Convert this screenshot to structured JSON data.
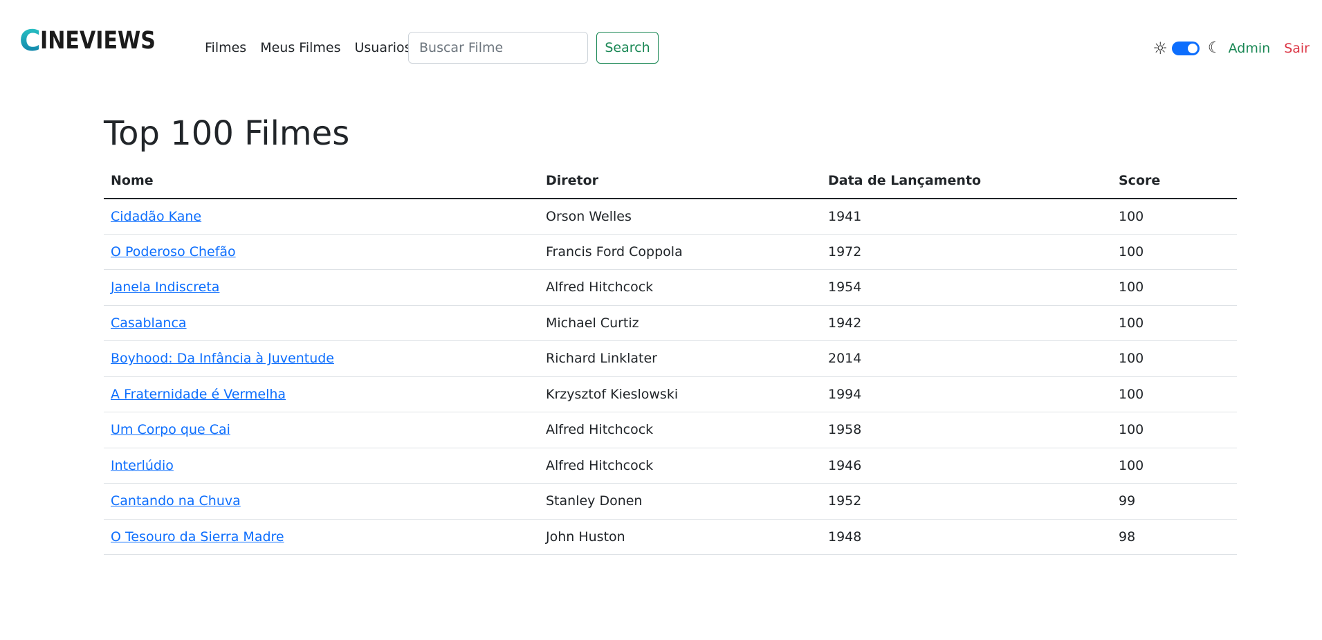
{
  "brand": {
    "logo_first": "C",
    "logo_rest": "INEVIEWS"
  },
  "nav": {
    "links": [
      "Filmes",
      "Meus Filmes",
      "Usuarios"
    ],
    "search_placeholder": "Buscar Filme",
    "search_label": "Search",
    "admin_label": "Admin",
    "logout_label": "Sair",
    "theme_toggle_on": true
  },
  "main": {
    "title": "Top 100 Filmes",
    "columns": [
      "Nome",
      "Diretor",
      "Data de Lançamento",
      "Score"
    ],
    "rows": [
      {
        "nome": "Cidadão Kane",
        "diretor": "Orson Welles",
        "ano": "1941",
        "score": "100"
      },
      {
        "nome": "O Poderoso Chefão",
        "diretor": "Francis Ford Coppola",
        "ano": "1972",
        "score": "100"
      },
      {
        "nome": "Janela Indiscreta",
        "diretor": "Alfred Hitchcock",
        "ano": "1954",
        "score": "100"
      },
      {
        "nome": "Casablanca",
        "diretor": "Michael Curtiz",
        "ano": "1942",
        "score": "100"
      },
      {
        "nome": "Boyhood: Da Infância à Juventude",
        "diretor": "Richard Linklater",
        "ano": "2014",
        "score": "100"
      },
      {
        "nome": "A Fraternidade é Vermelha",
        "diretor": "Krzysztof Kieslowski",
        "ano": "1994",
        "score": "100"
      },
      {
        "nome": "Um Corpo que Cai",
        "diretor": "Alfred Hitchcock",
        "ano": "1958",
        "score": "100"
      },
      {
        "nome": "Interlúdio",
        "diretor": "Alfred Hitchcock",
        "ano": "1946",
        "score": "100"
      },
      {
        "nome": "Cantando na Chuva",
        "diretor": "Stanley Donen",
        "ano": "1952",
        "score": "99"
      },
      {
        "nome": "O Tesouro da Sierra Madre",
        "diretor": "John Huston",
        "ano": "1948",
        "score": "98"
      }
    ]
  },
  "icons": {
    "theme_light": "sun-icon",
    "theme_dark": "moon-icon"
  },
  "colors": {
    "accent_green": "#198754",
    "link_blue": "#0d6efd",
    "logout_red": "#dc3545",
    "toggle_blue": "#0d6efd"
  }
}
